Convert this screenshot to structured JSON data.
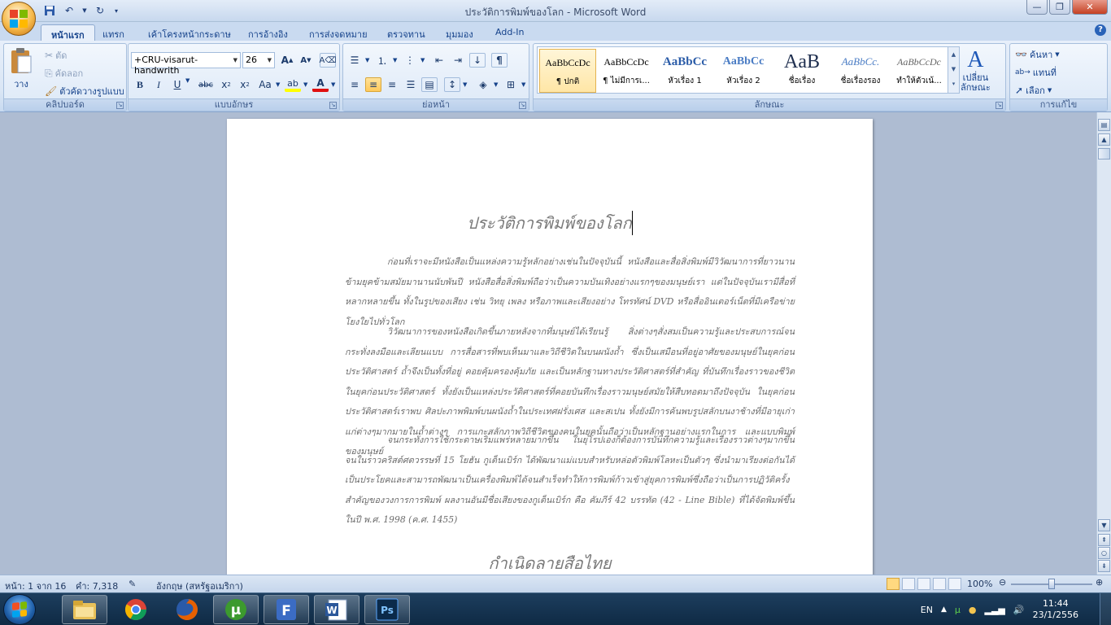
{
  "window": {
    "title": "ประวัติการพิมพ์ของโลก - Microsoft Word"
  },
  "ribbon_tabs": [
    "หน้าแรก",
    "แทรก",
    "เค้าโครงหน้ากระดาษ",
    "การอ้างอิง",
    "การส่งจดหมาย",
    "ตรวจทาน",
    "มุมมอง",
    "Add-In"
  ],
  "active_tab": "หน้าแรก",
  "clipboard": {
    "paste_label": "วาง",
    "cut_label": "ตัด",
    "copy_label": "คัดลอก",
    "format_painter_label": "ตัวคัดวางรูปแบบ",
    "group_label": "คลิปบอร์ด"
  },
  "font": {
    "name": "+CRU-visarut-handwrith",
    "size": "26",
    "group_label": "แบบอักษร"
  },
  "paragraph": {
    "group_label": "ย่อหน้า"
  },
  "styles": {
    "group_label": "ลักษณะ",
    "items": [
      {
        "preview": "AaBbCcDc",
        "name": "¶ ปกติ"
      },
      {
        "preview": "AaBbCcDc",
        "name": "¶ ไม่มีการเ..."
      },
      {
        "preview": "AaBbCc",
        "name": "หัวเรื่อง 1"
      },
      {
        "preview": "AaBbCc",
        "name": "หัวเรื่อง 2"
      },
      {
        "preview": "AaB",
        "name": "ชื่อเรื่อง"
      },
      {
        "preview": "AaBbCc.",
        "name": "ชื่อเรื่องรอง"
      },
      {
        "preview": "AaBbCcDc",
        "name": "ทำให้ตัวเน้..."
      }
    ],
    "change_styles_label": "เปลี่ยน\nลักษณะ"
  },
  "editing": {
    "find_label": "ค้นหา",
    "replace_label": "แทนที่",
    "select_label": "เลือก",
    "group_label": "การแก้ไข"
  },
  "document": {
    "title": "ประวัติการพิมพ์ของโลก",
    "paragraphs": [
      "ก่อนที่เราจะมีหนังสือเป็นแหล่งความรู้หลักอย่างเช่นในปัจจุบันนี้ หนังสือและสื่อสิ่งพิมพ์มีวิวัฒนาการที่ยาวนานข้ามยุคข้ามสมัยมานานนับพันปี หนังสือสื่อสิ่งพิมพ์ถือว่าเป็นความบันเทิงอย่างแรกๆของมนุษย์เรา แต่ในปัจจุบันเรามีสื่อที่หลากหลายขึ้น ทั้งในรูปของเสียง เช่น วิทยุ เพลง หรือภาพและเสียงอย่าง โทรทัศน์ DVD หรือสื่ออินเตอร์เน็ตที่มีเครือข่ายโยงใยไปทั่วโลก",
      "วิวัฒนาการของหนังสือเกิดขึ้นภายหลังจากที่มนุษย์ได้เรียนรู้ สิ่งต่างๆสั่งสมเป็นความรู้และประสบการณ์จนกระทั่งลงมือและเลียนแบบ การสื่อสารที่พบเห็นมาและวิถีชีวิตในบนผนังถ้ำ ซึ่งเป็นเสมือนที่อยู่อาศัยของมนุษย์ในยุคก่อนประวัติศาสตร์ ถ้ำจึงเป็นทั้งที่อยู่ คอยคุ้มครองคุ้มภัย และเป็นหลักฐานทางประวัติศาสตร์ที่สำคัญ ที่บันทึกเรื่องราวของชีวิตในยุคก่อนประวัติศาสตร์ ทั้งยังเป็นแหล่งประวัติศาสตร์ที่คอยบันทึกเรื่องราวมนุษย์สมัยให้สืบทอดมาถึงปัจจุบัน ในยุคก่อนประวัติศาสตร์เราพบ ศิลปะภาพพิมพ์บนผนังถ้ำในประเทศฝรั่งเศส และสเปน ทั้งยังมีการค้นพบรูปสลักบนงาช้างที่มีอายุเก่าแก่ต่างๆมากมายในถ้ำต่างๆ การแกะสลักภาพวิถีชีวิตของคนในยุคนั้นถือว่าเป็นหลักฐานอย่างแรกในการ และแบบพิมพ์ของมนุษย์",
      "จนกระทั่งการใช้กระดาษเริ่มแพร่หลายมากขึ้น ในยุโรปเองก็ต้องการบันทึกความรู้และเรื่องราวต่างๆมากขึ้นจนในราวคริสต์ศตวรรษที่ 15 โยฮัน กูเต็นเบิร์ก ได้พัฒนาแม่แบบสำหรับหล่อตัวพิมพ์โลหะเป็นตัวๆ ซึ่งนำมาเรียงต่อกันได้ เป็นประโยคและสามารถพัฒนาเป็นเครื่องพิมพ์ได้จนสำเร็จทำให้การพิมพ์ก้าวเข้าสู่ยุคการพิมพ์ซึ่งถือว่าเป็นการปฏิวัติครั้งสำคัญของวงการการพิมพ์ ผลงานอันมีชื่อเสียงของกูเต็นเบิร์ก คือ คัมภีร์ 42 บรรทัด (42 - Line Bible) ที่ได้จัดพิมพ์ขึ้นในปี พ.ศ. 1998 (ค.ศ. 1455)"
    ],
    "next_heading": "กำเนิดลายสือไทย"
  },
  "status": {
    "page": "หน้า: 1 จาก 16",
    "words": "คำ: 7,318",
    "language": "อังกฤษ (สหรัฐอเมริกา)",
    "zoom": "100%"
  },
  "taskbar": {
    "apps": [
      "windows-explorer",
      "google-chrome",
      "firefox",
      "utorrent",
      "foxit-reader",
      "microsoft-word",
      "photoshop"
    ],
    "lang": "EN",
    "time": "11:44",
    "date": "23/1/2556"
  }
}
